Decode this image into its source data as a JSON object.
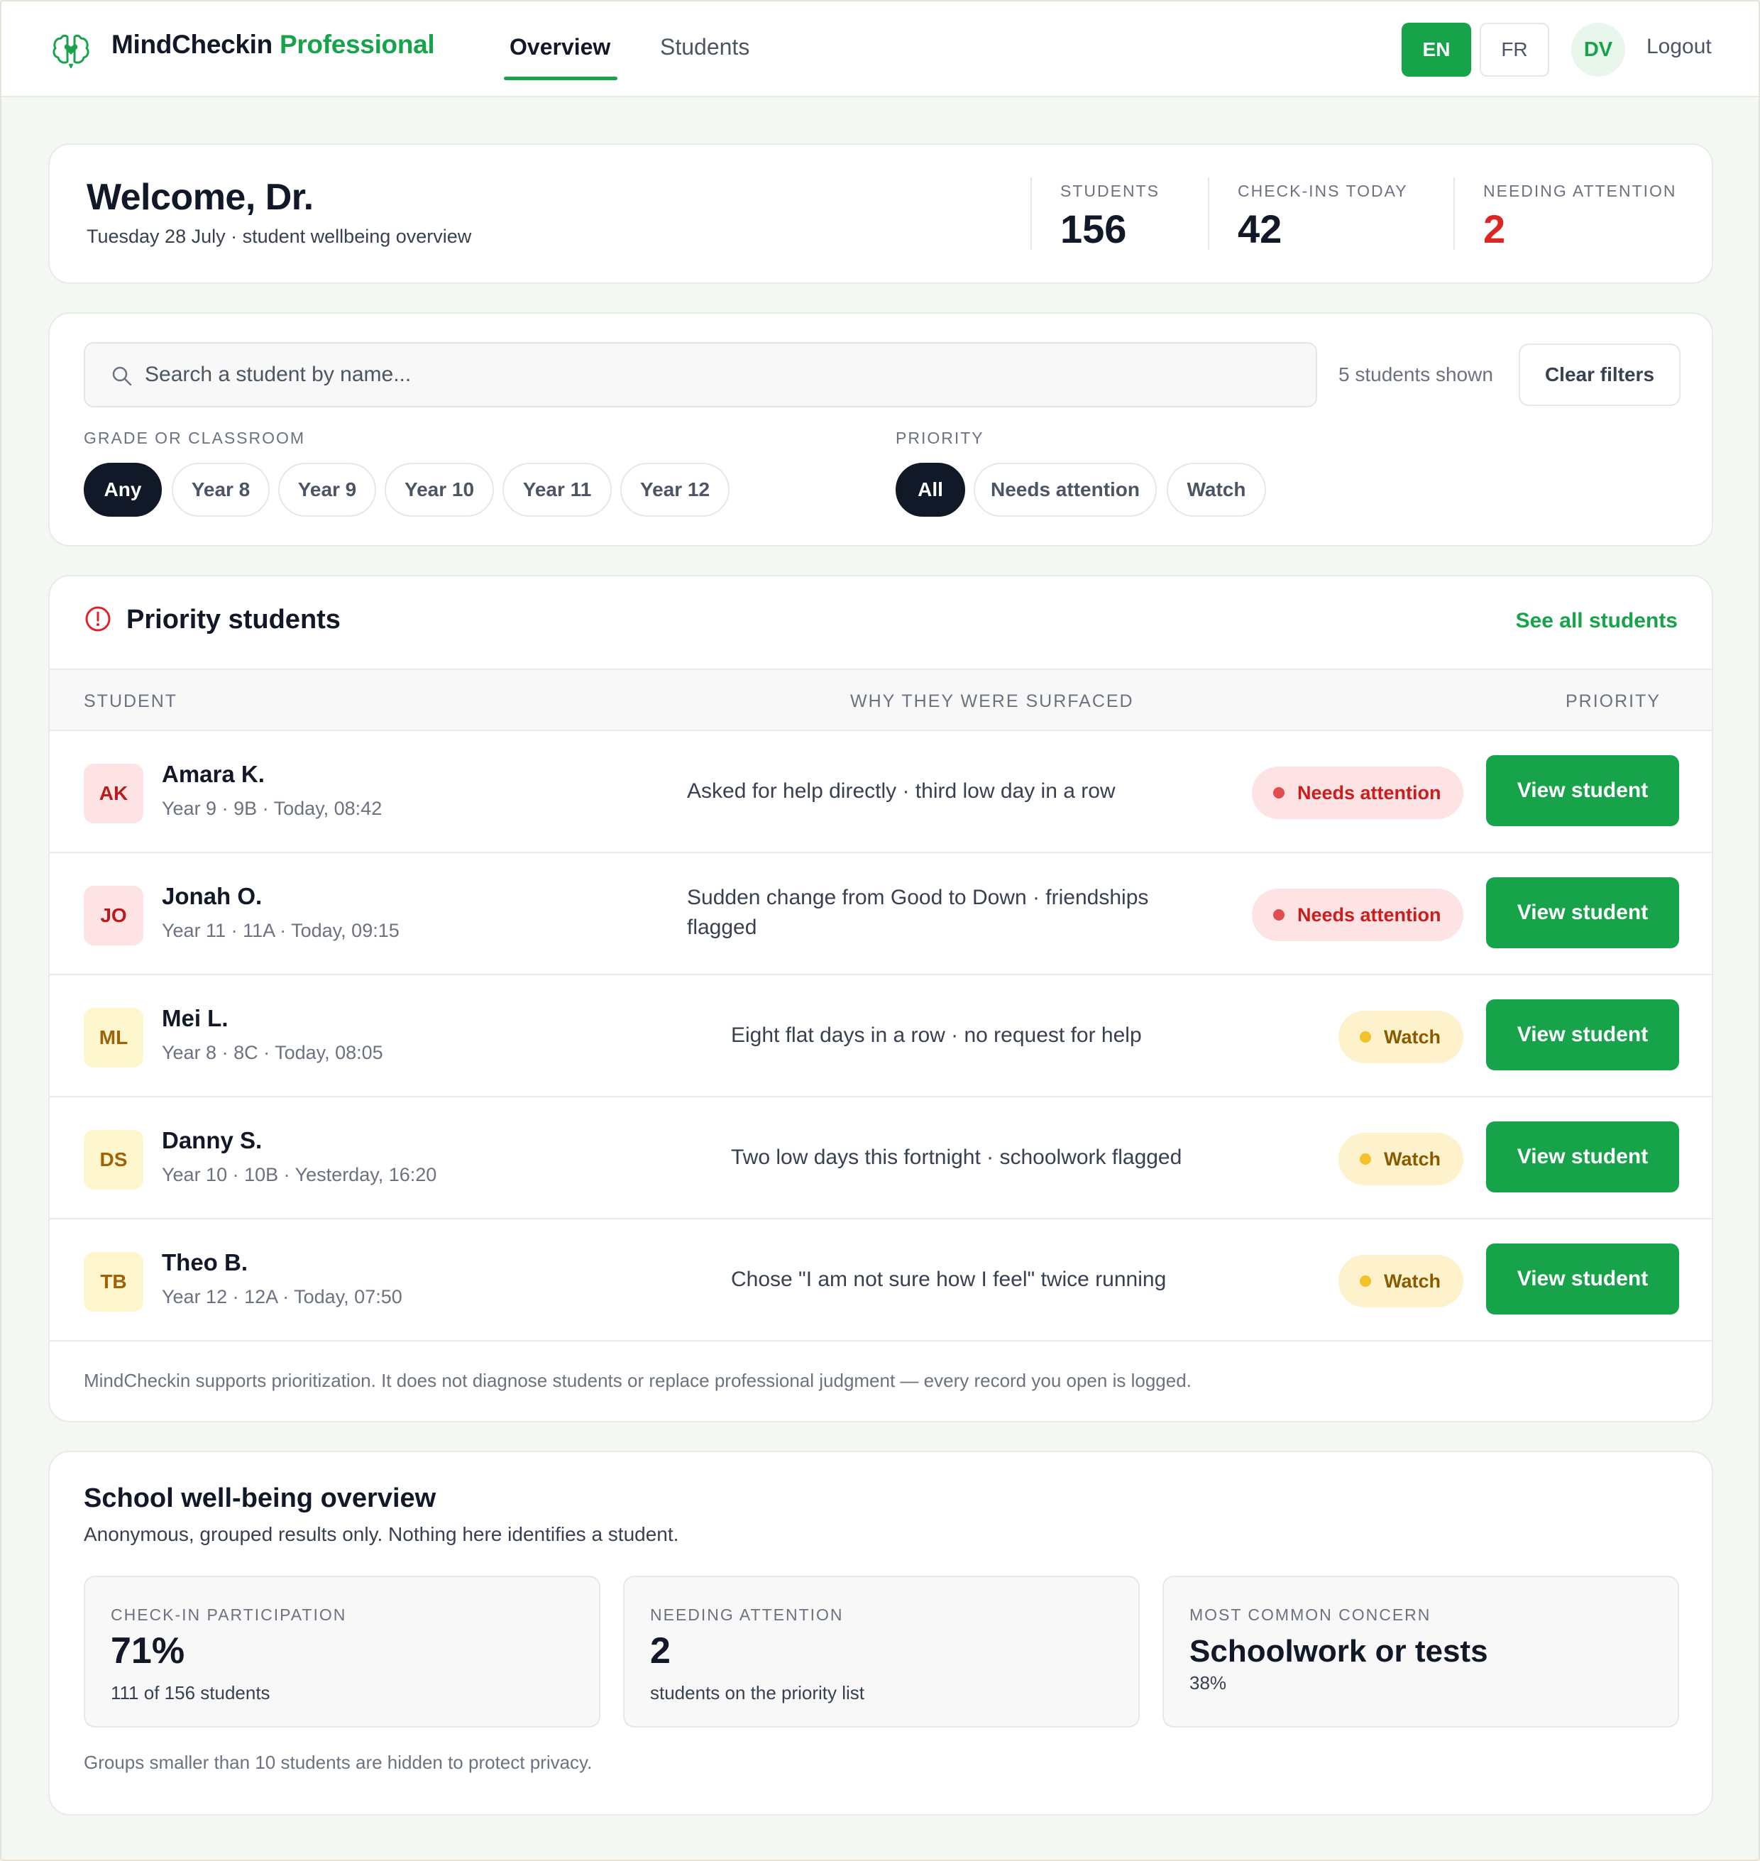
{
  "header": {
    "brand_main": "MindCheckin",
    "brand_accent": "Professional",
    "nav": {
      "overview": "Overview",
      "students": "Students"
    },
    "lang_en": "EN",
    "lang_fr": "FR",
    "user_initials": "DV",
    "logout": "Logout",
    "active_tab": "Overview"
  },
  "welcome": {
    "title": "Welcome, Dr.",
    "subtitle": "Tuesday 28 July · student wellbeing overview",
    "stats": [
      {
        "label": "STUDENTS",
        "value": "156"
      },
      {
        "label": "CHECK-INS TODAY",
        "value": "42"
      },
      {
        "label": "NEEDING ATTENTION",
        "value": "2"
      }
    ]
  },
  "filters": {
    "search_placeholder": "Search a student by name...",
    "search_value": "",
    "shown_text": "5 students shown",
    "clear_label": "Clear filters",
    "grade_label": "GRADE OR CLASSROOM",
    "grade_chips": [
      "Any",
      "Year 8",
      "Year 9",
      "Year 10",
      "Year 11",
      "Year 12"
    ],
    "grade_selected": "Any",
    "priority_label": "PRIORITY",
    "priority_chips": [
      "All",
      "Needs attention",
      "Watch"
    ],
    "priority_selected": "All"
  },
  "priority": {
    "title": "Priority students",
    "see_all": "See all students",
    "columns": {
      "student": "STUDENT",
      "why": "WHY THEY WERE SURFACED",
      "priority": "PRIORITY"
    },
    "rows": [
      {
        "initials": "AK",
        "name": "Amara K.",
        "meta": "Year 9 · 9B · Today, 08:42",
        "reason": "Asked for help directly · third low day in a row",
        "priority": "Needs attention",
        "action": "View student"
      },
      {
        "initials": "JO",
        "name": "Jonah O.",
        "meta": "Year 11 · 11A · Today, 09:15",
        "reason": "Sudden change from Good to Down · friendships flagged",
        "priority": "Needs attention",
        "action": "View student"
      },
      {
        "initials": "ML",
        "name": "Mei L.",
        "meta": "Year 8 · 8C · Today, 08:05",
        "reason": "Eight flat days in a row · no request for help",
        "priority": "Watch",
        "action": "View student"
      },
      {
        "initials": "DS",
        "name": "Danny S.",
        "meta": "Year 10 · 10B · Yesterday, 16:20",
        "reason": "Two low days this fortnight · schoolwork flagged",
        "priority": "Watch",
        "action": "View student"
      },
      {
        "initials": "TB",
        "name": "Theo B.",
        "meta": "Year 12 · 12A · Today, 07:50",
        "reason": "Chose \"I am not sure how I feel\" twice running",
        "priority": "Watch",
        "action": "View student"
      }
    ],
    "disclaimer": "MindCheckin supports prioritization. It does not diagnose students or replace professional judgment — every record you open is logged."
  },
  "overview": {
    "title": "School well-being overview",
    "subtitle": "Anonymous, grouped results only. Nothing here identifies a student.",
    "boxes": [
      {
        "label": "CHECK-IN PARTICIPATION",
        "value": "71%",
        "note": "111 of 156 students"
      },
      {
        "label": "NEEDING ATTENTION",
        "value": "2",
        "note": "students on the priority list"
      },
      {
        "label": "MOST COMMON CONCERN",
        "value": "Schoolwork or tests",
        "note": "38%"
      }
    ],
    "footer": "Groups smaller than 10 students are hidden to protect privacy."
  },
  "colors": {
    "accent_green": "#17a34a",
    "alert_red": "#dc2626",
    "watch_yellow": "#f3c22b",
    "dark": "#111827"
  }
}
